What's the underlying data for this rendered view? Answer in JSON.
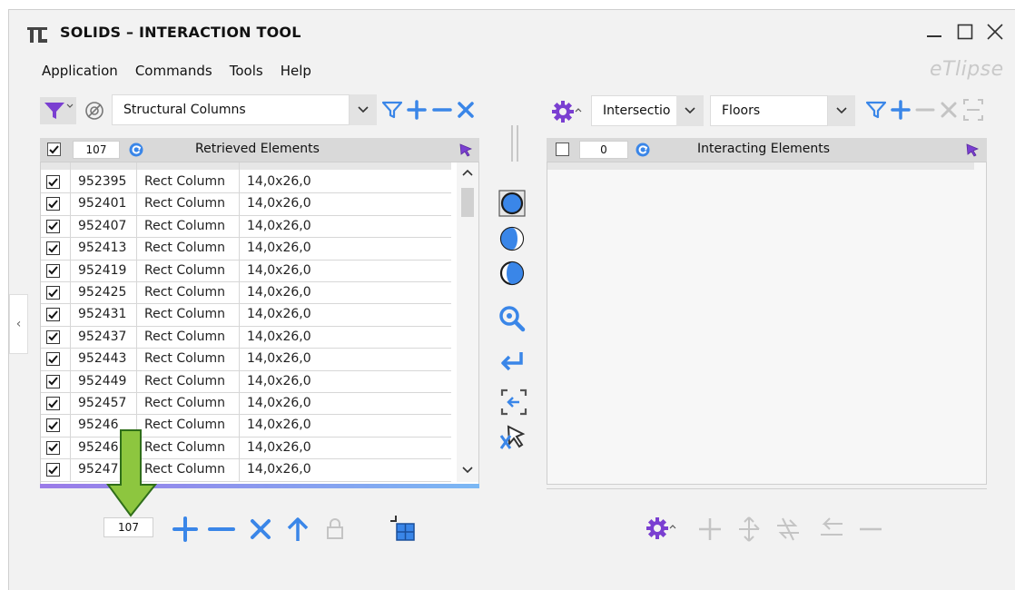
{
  "window": {
    "title": "SOLIDS – INTERACTION TOOL"
  },
  "menu": [
    "Application",
    "Commands",
    "Tools",
    "Help"
  ],
  "brand": "eTlipse",
  "left_toolbar": {
    "category_value": "Structural Columns"
  },
  "left_header": {
    "count": "107",
    "title": "Retrieved Elements"
  },
  "rows": [
    {
      "id": "952395",
      "type": "Rect Column",
      "size": "14,0x26,0"
    },
    {
      "id": "952401",
      "type": "Rect Column",
      "size": "14,0x26,0"
    },
    {
      "id": "952407",
      "type": "Rect Column",
      "size": "14,0x26,0"
    },
    {
      "id": "952413",
      "type": "Rect Column",
      "size": "14,0x26,0"
    },
    {
      "id": "952419",
      "type": "Rect Column",
      "size": "14,0x26,0"
    },
    {
      "id": "952425",
      "type": "Rect Column",
      "size": "14,0x26,0"
    },
    {
      "id": "952431",
      "type": "Rect Column",
      "size": "14,0x26,0"
    },
    {
      "id": "952437",
      "type": "Rect Column",
      "size": "14,0x26,0"
    },
    {
      "id": "952443",
      "type": "Rect Column",
      "size": "14,0x26,0"
    },
    {
      "id": "952449",
      "type": "Rect Column",
      "size": "14,0x26,0"
    },
    {
      "id": "952457",
      "type": "Rect Column",
      "size": "14,0x26,0"
    },
    {
      "id": "95246",
      "type": "Rect Column",
      "size": "14,0x26,0"
    },
    {
      "id": "95246",
      "type": "Rect Column",
      "size": "14,0x26,0"
    },
    {
      "id": "95247",
      "type": "Rect Column",
      "size": "14,0x26,0"
    }
  ],
  "right_toolbar": {
    "mode_value": "Intersectio",
    "category_value": "Floors"
  },
  "right_header": {
    "count": "0",
    "title": "Interacting Elements"
  },
  "bottom_left": {
    "count": "107"
  },
  "colors": {
    "accent_blue": "#3a86e8",
    "accent_purple": "#7a3fd1",
    "highlight_green": "#8dc63f",
    "disabled_gray": "#c4c4c4"
  }
}
